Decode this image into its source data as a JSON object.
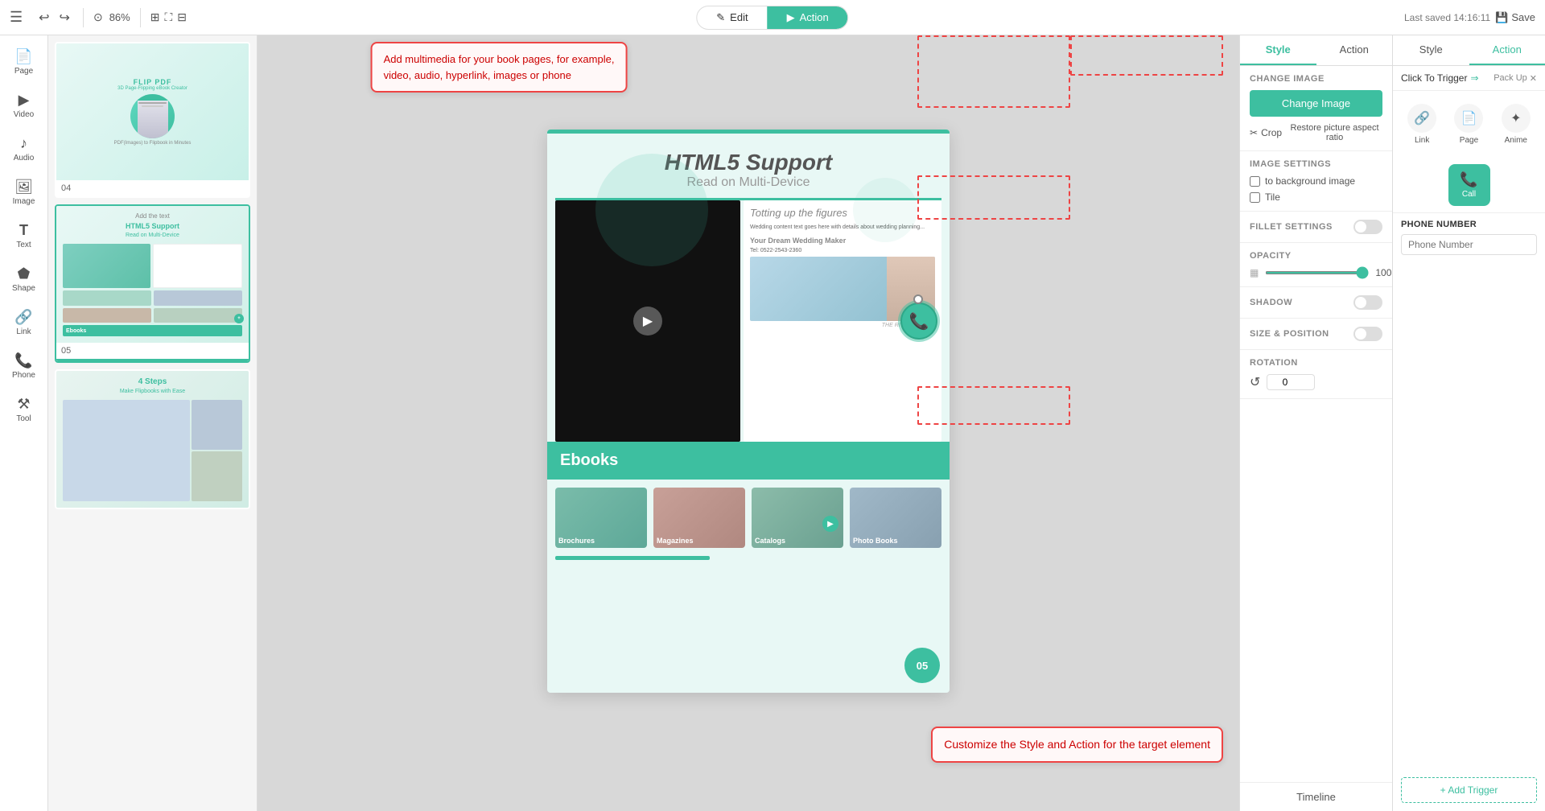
{
  "topbar": {
    "menu_icon": "☰",
    "undo_icon": "↩",
    "redo_icon": "↪",
    "zoom": "86%",
    "edit_tab": "Edit",
    "action_tab": "Action",
    "last_saved": "Last saved 14:16:11",
    "save_label": "Save"
  },
  "sidebar": {
    "items": [
      {
        "id": "page",
        "icon": "📄",
        "label": "Page"
      },
      {
        "id": "video",
        "icon": "▶",
        "label": "Video"
      },
      {
        "id": "audio",
        "icon": "🎵",
        "label": "Audio"
      },
      {
        "id": "image",
        "icon": "🖼",
        "label": "Image"
      },
      {
        "id": "text",
        "icon": "T",
        "label": "Text"
      },
      {
        "id": "shape",
        "icon": "⬟",
        "label": "Shape"
      },
      {
        "id": "link",
        "icon": "🔗",
        "label": "Link"
      },
      {
        "id": "phone",
        "icon": "📞",
        "label": "Phone"
      },
      {
        "id": "tool",
        "icon": "⚒",
        "label": "Tool"
      }
    ]
  },
  "pages": [
    {
      "num": "04",
      "active": false
    },
    {
      "num": "05",
      "active": true
    },
    {
      "num": "",
      "active": false
    }
  ],
  "canvas": {
    "title": "HTML5 Support",
    "subtitle": "Read on Multi-Device",
    "ebooks_label": "Ebooks",
    "page_number": "05",
    "bottom_thumbs": [
      {
        "label": "Brochures",
        "bg": "#8bc4b0"
      },
      {
        "label": "Magazines",
        "bg": "#c0a8a0"
      },
      {
        "label": "Catalogs",
        "bg": "#9cb8a8"
      },
      {
        "label": "Photo Books",
        "bg": "#a0b8c8"
      }
    ]
  },
  "tooltip_top": "Add multimedia for your book pages, for example,\nvideo, audio, hyperlink, images or phone",
  "tooltip_bottom": "Customize the Style and Action for the target element",
  "style_panel": {
    "style_tab": "Style",
    "action_tab": "Action",
    "change_image_section": "CHANGE IMAGE",
    "change_image_btn": "Change Image",
    "crop_label": "Crop",
    "restore_label": "Restore picture aspect ratio",
    "image_settings_section": "IMAGE SETTINGS",
    "to_background_label": "to background image",
    "tile_label": "Tile",
    "fillet_section": "FILLET SETTINGS",
    "opacity_section": "OPACITY",
    "opacity_value": "100",
    "shadow_section": "SHADOW",
    "size_position_section": "SIZE & POSITION",
    "rotation_section": "ROTATION",
    "rotation_value": "0",
    "timeline_btn": "Timeline"
  },
  "action_panel": {
    "style_tab": "Style",
    "action_tab": "Action",
    "click_trigger": "Click To Trigger",
    "pack_up": "Pack Up",
    "icons": [
      {
        "id": "link",
        "icon": "🔗",
        "label": "Link"
      },
      {
        "id": "page",
        "icon": "📄",
        "label": "Page"
      },
      {
        "id": "anime",
        "icon": "✦",
        "label": "Anime"
      }
    ],
    "call_label": "Call",
    "phone_number_section": "PHONE NUMBER",
    "phone_placeholder": "Phone Number",
    "add_trigger": "+ Add Trigger"
  }
}
